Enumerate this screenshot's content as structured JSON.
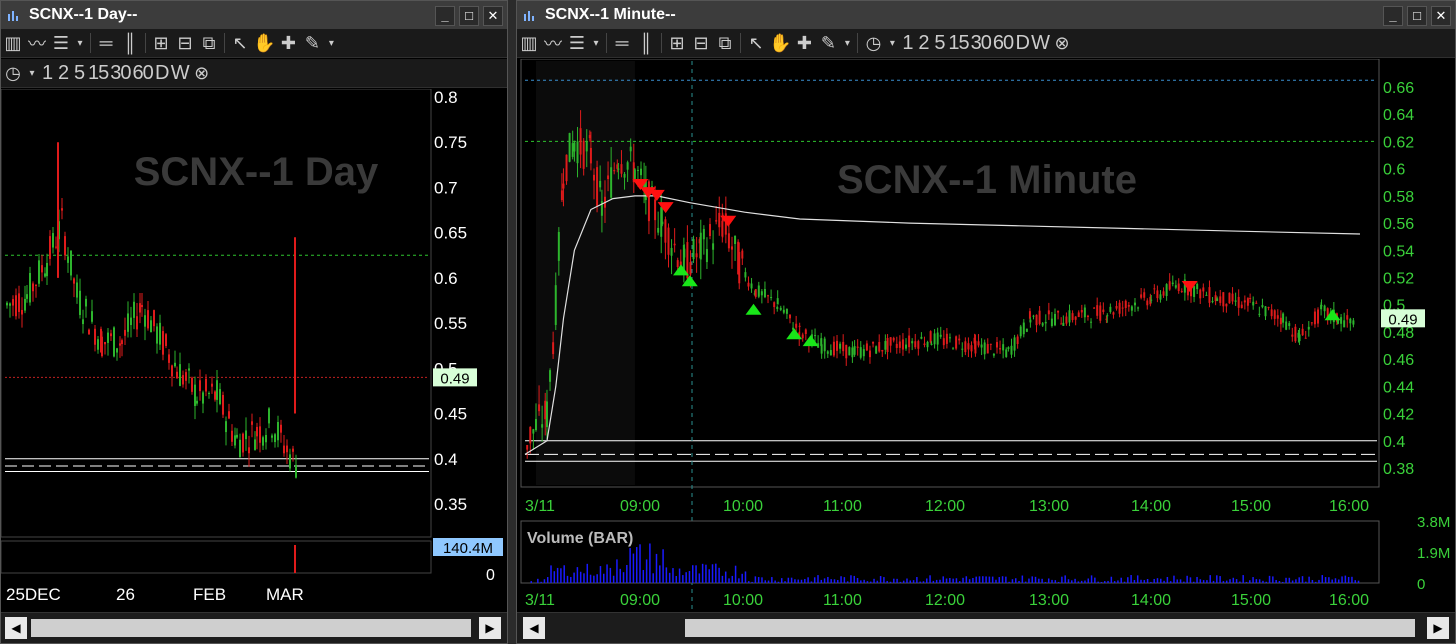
{
  "day_window": {
    "title": "SCNX--1 Day--",
    "watermark": "SCNX--1 Day",
    "price_label": "0.49",
    "volume_label": "140.4M",
    "volume_axis_zero": "0",
    "y_ticks": [
      "0.8",
      "0.75",
      "0.7",
      "0.65",
      "0.6",
      "0.55",
      "0.5",
      "0.45",
      "0.4",
      "0.35"
    ],
    "x_labels": [
      "25DEC",
      "26",
      "FEB",
      "MAR"
    ],
    "window_controls": [
      "_",
      "□",
      "✕"
    ]
  },
  "minute_window": {
    "title": "SCNX--1 Minute--",
    "watermark": "SCNX--1 Minute",
    "price_label": "0.49",
    "volume_title": "Volume (BAR)",
    "y_ticks": [
      "0.66",
      "0.64",
      "0.62",
      "0.6",
      "0.58",
      "0.56",
      "0.54",
      "0.52",
      "0.5",
      "0.48",
      "0.46",
      "0.44",
      "0.42",
      "0.4",
      "0.38"
    ],
    "x_labels": [
      "3/11",
      "09:00",
      "10:00",
      "11:00",
      "12:00",
      "13:00",
      "14:00",
      "15:00",
      "16:00"
    ],
    "volume_ticks": [
      "3.8M",
      "1.9M",
      "0"
    ],
    "window_controls": [
      "_",
      "□",
      "✕"
    ]
  },
  "toolbar": {
    "timeframes": [
      "1",
      "2",
      "5",
      "15",
      "30",
      "60",
      "D",
      "W"
    ],
    "icons": [
      "bar-chart-icon",
      "line-chart-icon",
      "candle-chart-icon",
      "dropdown-arrow-icon",
      "horizontal-lines-icon",
      "vertical-lines-icon",
      "zoom-in-icon",
      "zoom-out-icon",
      "zoom-fit-icon",
      "pointer-icon",
      "hand-pan-icon",
      "crosshair-icon",
      "pencil-icon",
      "clock-icon",
      "close-circle-icon"
    ]
  },
  "colors": {
    "up": "#2db52d",
    "down": "#e01b1b",
    "axis_text": "#3ad13a",
    "axis_text_day": "#ffffff",
    "green_dash": "#2ec42e",
    "blue_dash": "#3a8fd0",
    "red_dot": "#c02020",
    "vwap": "#e0e0e0",
    "volume": "#1a1aff",
    "price_box": "#d8ffd8"
  }
}
